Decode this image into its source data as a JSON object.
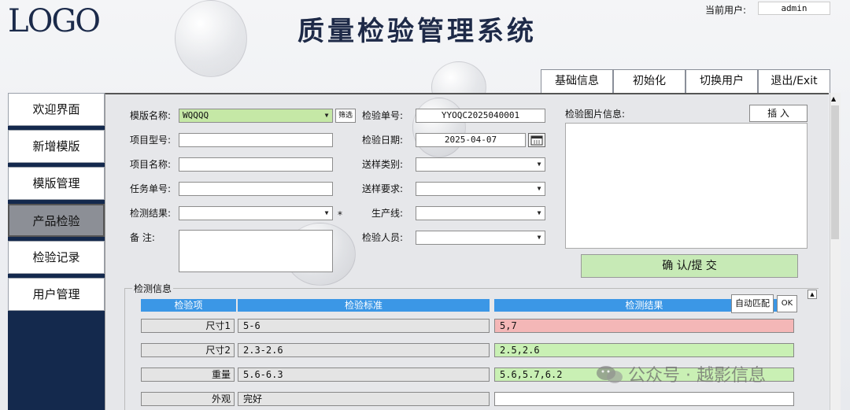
{
  "header": {
    "logo": "LOGO",
    "title": "质量检验管理系统",
    "current_user_label": "当前用户:",
    "current_user": "admin"
  },
  "top_buttons": [
    "基础信息",
    "初始化",
    "切换用户",
    "退出/Exit"
  ],
  "sidebar": {
    "items": [
      {
        "label": "欢迎界面",
        "active": false
      },
      {
        "label": "新增模版",
        "active": false
      },
      {
        "label": "模版管理",
        "active": false
      },
      {
        "label": "产品检验",
        "active": true
      },
      {
        "label": "检验记录",
        "active": false
      },
      {
        "label": "用户管理",
        "active": false
      }
    ]
  },
  "form": {
    "template_label": "模版名称:",
    "template_value": "WQQQQ",
    "filter_button": "筛选",
    "project_model_label": "项目型号:",
    "project_model_value": "",
    "project_name_label": "项目名称:",
    "project_name_value": "",
    "task_no_label": "任务单号:",
    "task_no_value": "",
    "result_label": "检测结果:",
    "result_value": "",
    "required_mark": "*",
    "remark_label": "备  注:",
    "remark_value": "",
    "inspect_no_label": "检验单号:",
    "inspect_no_value": "YYOQC2025040001",
    "inspect_date_label": "检验日期:",
    "inspect_date_value": "2025-04-07",
    "sample_type_label": "送样类别:",
    "sample_type_value": "",
    "sample_req_label": "送样要求:",
    "sample_req_value": "",
    "line_label": "生产线:",
    "line_value": "",
    "inspector_label": "检验人员:",
    "inspector_value": ""
  },
  "image_panel": {
    "label": "检验图片信息:",
    "insert_button": "插 入",
    "confirm_button": "确 认/提 交"
  },
  "detection": {
    "section_title": "检测信息",
    "columns": [
      "检验项",
      "检验标准",
      "检测结果"
    ],
    "auto_match_button": "自动匹配",
    "ok_button": "OK",
    "rows": [
      {
        "item": "尺寸1",
        "standard": "5-6",
        "result": "5,7",
        "status": "fail"
      },
      {
        "item": "尺寸2",
        "standard": "2.3-2.6",
        "result": "2.5,2.6",
        "status": "pass"
      },
      {
        "item": "重量",
        "standard": "5.6-6.3",
        "result": "5.6,5.7,6.2",
        "status": "pass"
      },
      {
        "item": "外观",
        "standard": "完好",
        "result": "",
        "status": "none"
      }
    ]
  },
  "colors": {
    "sidebar_bg": "#14294d",
    "header_blue": "#3b97e6",
    "pass_green": "#c9f0b4",
    "fail_red": "#f4b7b7",
    "confirm_green": "#c7eab6",
    "template_green": "#c5e8a6"
  },
  "watermark": "公众号 · 越影信息"
}
